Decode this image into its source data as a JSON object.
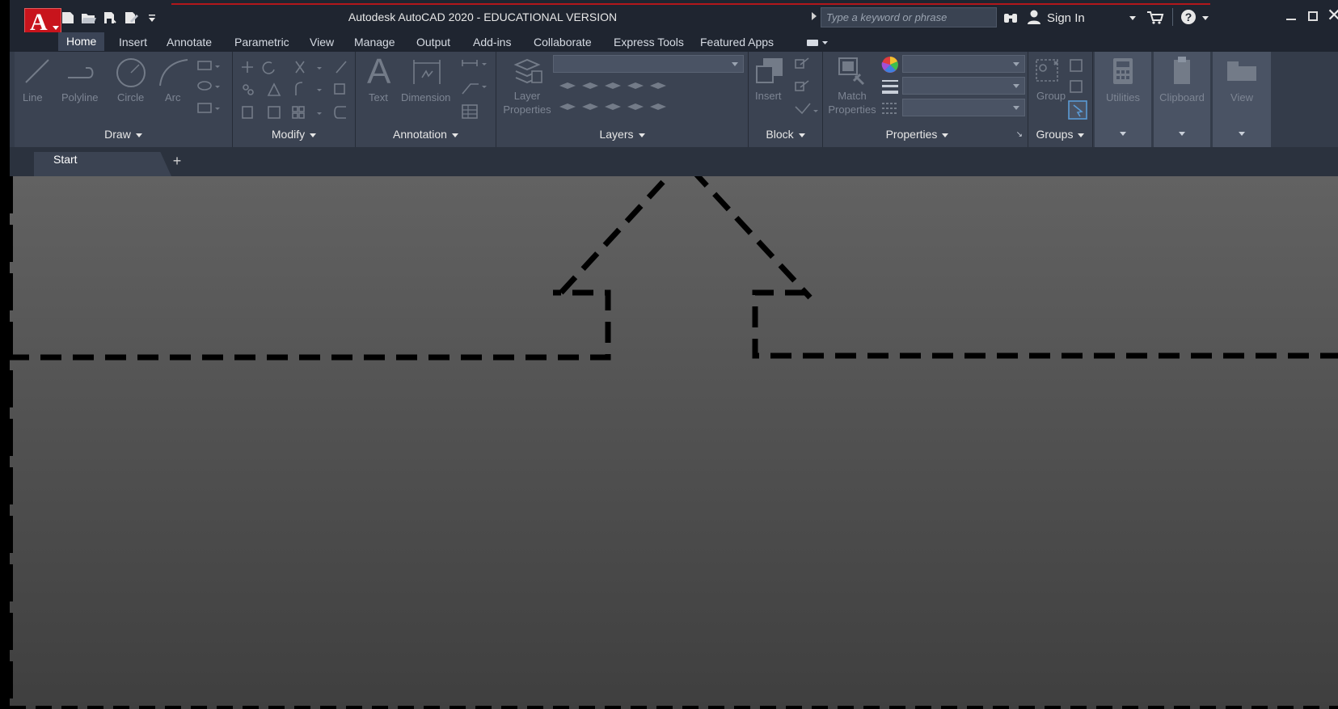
{
  "title_bar": {
    "app_title": "Autodesk AutoCAD 2020 - EDUCATIONAL VERSION",
    "search_placeholder": "Type a keyword or phrase",
    "sign_in": "Sign In"
  },
  "menu_tabs": [
    "Home",
    "Insert",
    "Annotate",
    "Parametric",
    "View",
    "Manage",
    "Output",
    "Add-ins",
    "Collaborate",
    "Express Tools",
    "Featured Apps"
  ],
  "active_tab": "Home",
  "ribbon": {
    "draw": {
      "title": "Draw",
      "tools": [
        "Line",
        "Polyline",
        "Circle",
        "Arc"
      ]
    },
    "modify": {
      "title": "Modify"
    },
    "annotation": {
      "title": "Annotation",
      "tools": [
        "Text",
        "Dimension"
      ]
    },
    "layers": {
      "title": "Layers",
      "tools": [
        "Layer",
        "Properties"
      ]
    },
    "block": {
      "title": "Block",
      "tools": [
        "Insert"
      ]
    },
    "properties": {
      "title": "Properties",
      "tools": [
        "Match",
        "Properties"
      ]
    },
    "groups": {
      "title": "Groups",
      "tools": [
        "Group"
      ]
    },
    "utilities": {
      "title": "Utilities"
    },
    "clipboard": {
      "title": "Clipboard"
    },
    "view": {
      "title": "View"
    }
  },
  "document_tabs": {
    "start": "Start",
    "new_tab": "+"
  },
  "colors": {
    "title_bg": "#1f2530",
    "ribbon_bg": "#343c4a",
    "panel_bg": "#3b4352",
    "logo_red": "#c8141c",
    "canvas_top": "#626262",
    "canvas_bottom": "#3f3f3f",
    "drawing_line": "#000000"
  }
}
